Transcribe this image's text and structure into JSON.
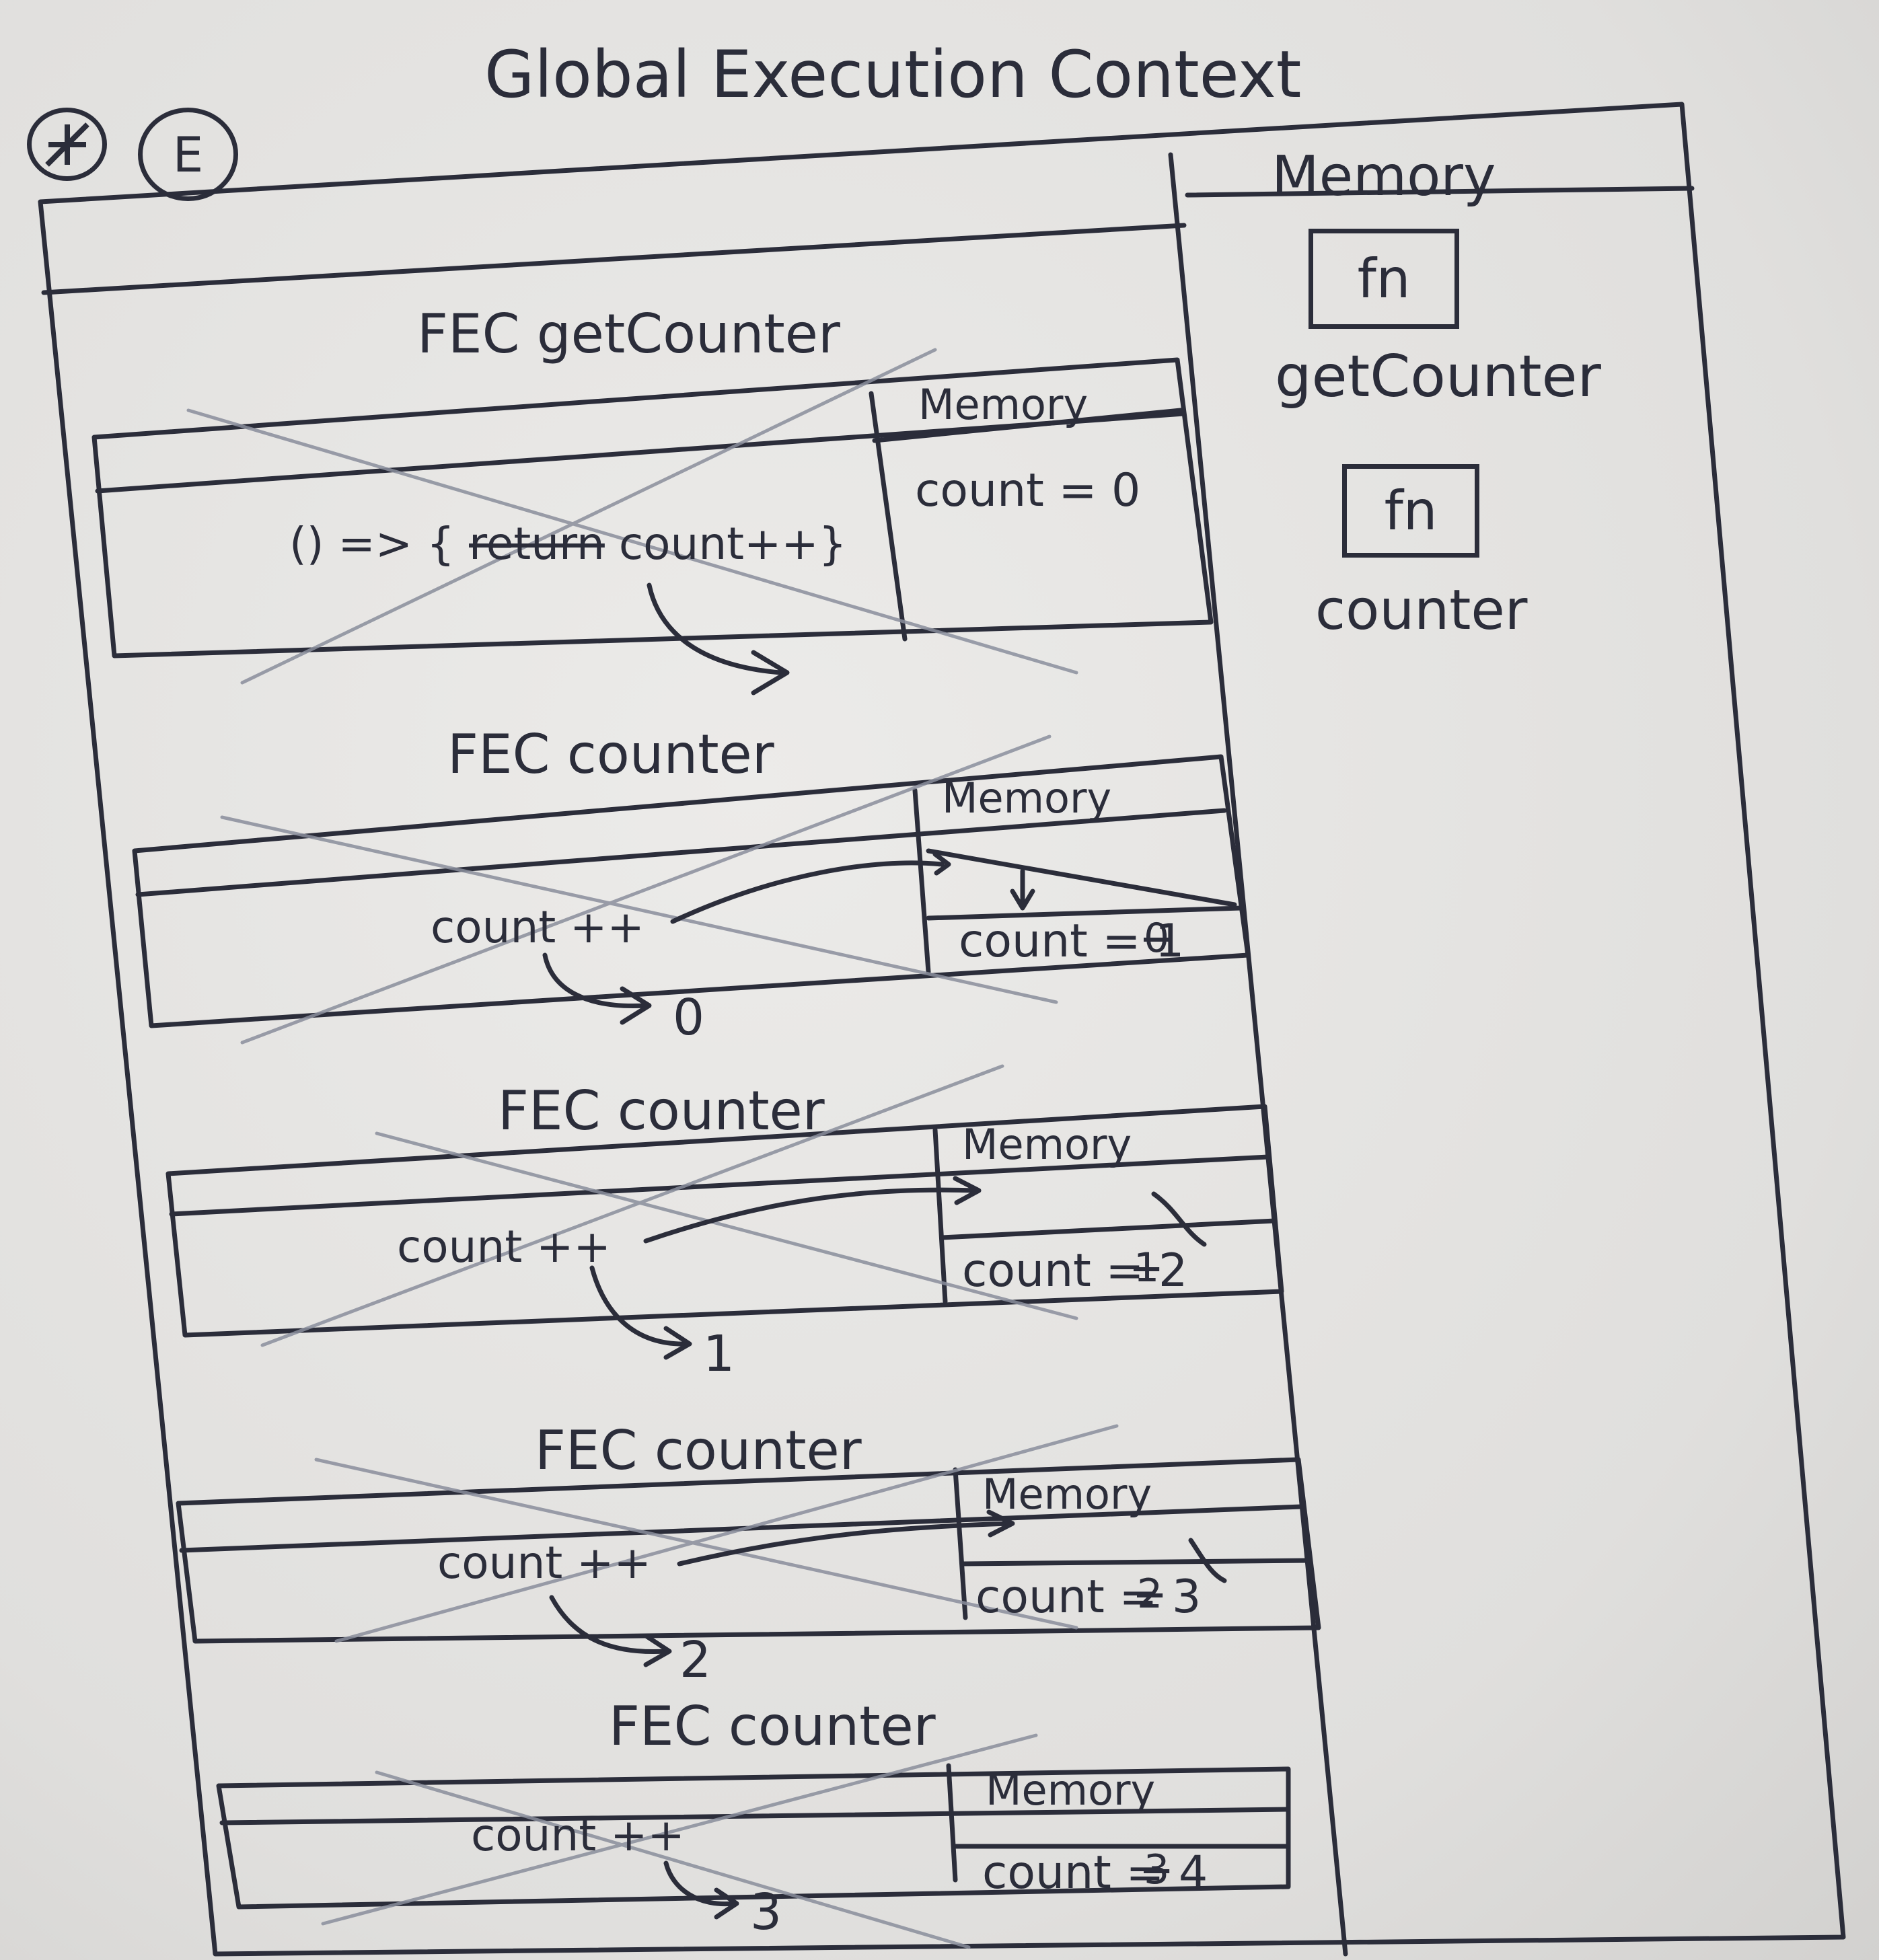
{
  "diagram": {
    "title": "Global Execution Context",
    "markers": [
      "E"
    ],
    "global_memory": {
      "label": "Memory",
      "entries": [
        {
          "icon": "fn",
          "name": "getCounter"
        },
        {
          "icon": "fn",
          "name": "counter"
        }
      ]
    },
    "contexts": [
      {
        "title": "FEC getCounter",
        "memory_label": "Memory",
        "code": "() => { return count++}",
        "code_struck_word": "return",
        "memory_value": "count = 0"
      },
      {
        "title": "FEC counter",
        "memory_label": "Memory",
        "code": "count ++",
        "memory_old": "0",
        "memory_value": "count = 1",
        "returns": "0"
      },
      {
        "title": "FEC counter",
        "memory_label": "Memory",
        "code": "count ++",
        "memory_old": "1",
        "memory_value": "count = 2",
        "returns": "1"
      },
      {
        "title": "FEC counter",
        "memory_label": "Memory",
        "code": "count ++",
        "memory_old": "2",
        "memory_value": "count = 3",
        "returns": "2"
      },
      {
        "title": "FEC counter",
        "memory_label": "Memory",
        "code": "count ++",
        "memory_old": "3",
        "memory_value": "count = 4",
        "returns": "3"
      }
    ]
  },
  "colors": {
    "ink": "#2b2d3a",
    "paper": "#e5e4e2",
    "cross": "#8a8e9c"
  }
}
